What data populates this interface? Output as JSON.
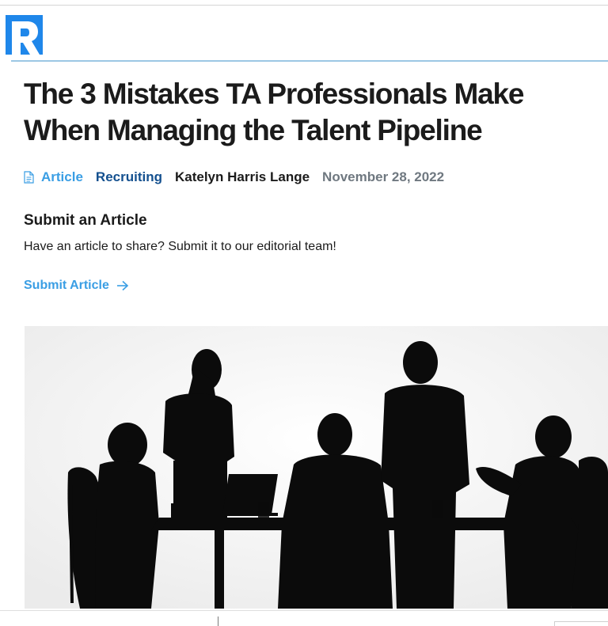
{
  "header": {
    "logo_icon": "r-logo-icon",
    "brand_color": "#1f87ea"
  },
  "article": {
    "title": "The 3 Mistakes TA Professionals Make When Managing the Talent Pipeline",
    "meta": {
      "type_icon": "document-icon",
      "type": "Article",
      "category": "Recruiting",
      "author": "Katelyn Harris Lange",
      "date": "November 28, 2022"
    }
  },
  "submit": {
    "heading": "Submit an Article",
    "text": "Have an article to share? Submit it to our editorial team!",
    "link_label": "Submit Article",
    "link_icon": "arrow-right-icon"
  },
  "hero_image": {
    "subject": "silhouette-business-meeting-image"
  },
  "colors": {
    "accent": "#3a9ee4",
    "category": "#14508f",
    "date": "#6f7880",
    "text": "#1b1b1b"
  }
}
